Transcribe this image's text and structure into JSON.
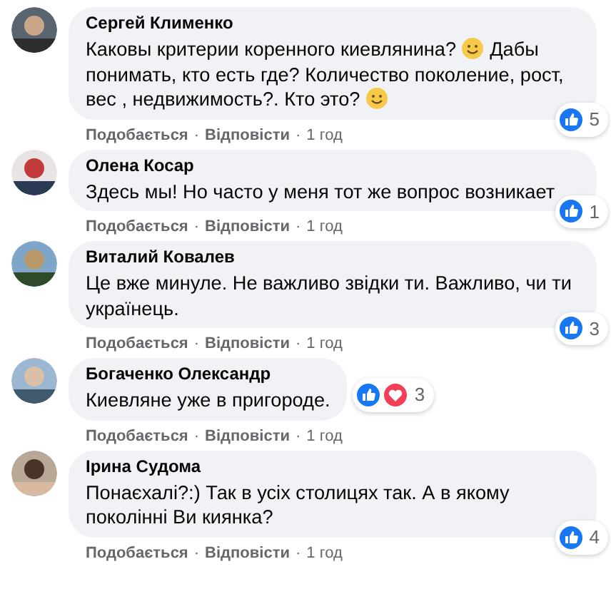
{
  "comments": [
    {
      "author": "Сергей Клименко",
      "lines": [
        [
          {
            "kind": "text",
            "text": "Каковы критерии коренного киевлянина? "
          },
          {
            "kind": "emoji"
          },
          {
            "kind": "text",
            "text": " Дабы"
          }
        ],
        [
          {
            "kind": "text",
            "text": "понимать, кто есть где? Количество поколение, рост,"
          }
        ],
        [
          {
            "kind": "text",
            "text": "вес , недвижимость?. Кто это? "
          },
          {
            "kind": "emoji"
          }
        ]
      ],
      "reactions": {
        "kind": "corner",
        "icons": [
          {
            "kind": "like"
          }
        ],
        "count": "5"
      },
      "actions": [
        {
          "kind": "link",
          "text": "Подобається"
        },
        {
          "kind": "separator",
          "text": "·"
        },
        {
          "kind": "link",
          "text": "Відповісти"
        },
        {
          "kind": "separator",
          "text": "·"
        },
        {
          "kind": "time",
          "text": "1 год"
        }
      ]
    },
    {
      "author": "Олена Косар",
      "lines": [
        [
          {
            "kind": "text",
            "text": "Здесь мы! Но часто у меня тот же вопрос возникает"
          }
        ]
      ],
      "reactions": {
        "kind": "corner",
        "icons": [
          {
            "kind": "like"
          }
        ],
        "count": "1"
      },
      "actions": [
        {
          "kind": "link",
          "text": "Подобається"
        },
        {
          "kind": "separator",
          "text": "·"
        },
        {
          "kind": "link",
          "text": "Відповісти"
        },
        {
          "kind": "separator",
          "text": "·"
        },
        {
          "kind": "time",
          "text": "1 год"
        }
      ]
    },
    {
      "author": "Виталий Ковалев",
      "lines": [
        [
          {
            "kind": "text",
            "text": "Це вже минуле. Не важливо звідки ти. Важливо, чи ти"
          }
        ],
        [
          {
            "kind": "text",
            "text": "українець."
          }
        ]
      ],
      "reactions": {
        "kind": "corner",
        "icons": [
          {
            "kind": "like"
          }
        ],
        "count": "3"
      },
      "actions": [
        {
          "kind": "link",
          "text": "Подобається"
        },
        {
          "kind": "separator",
          "text": "·"
        },
        {
          "kind": "link",
          "text": "Відповісти"
        },
        {
          "kind": "separator",
          "text": "·"
        },
        {
          "kind": "time",
          "text": "1 год"
        }
      ]
    },
    {
      "author": "Богаченко Олександр",
      "lines": [
        [
          {
            "kind": "text",
            "text": "Киевляне уже в пригороде."
          }
        ]
      ],
      "reactions": {
        "kind": "inline",
        "icons": [
          {
            "kind": "like"
          },
          {
            "kind": "love"
          }
        ],
        "count": "3"
      },
      "actions": [
        {
          "kind": "link",
          "text": "Подобається"
        },
        {
          "kind": "separator",
          "text": "·"
        },
        {
          "kind": "link",
          "text": "Відповісти"
        },
        {
          "kind": "separator",
          "text": "·"
        },
        {
          "kind": "time",
          "text": "1 год"
        }
      ]
    },
    {
      "author": "Ірина Судома",
      "lines": [
        [
          {
            "kind": "text",
            "text": "Понаєхалі?:) Так в усіх столицях так. А в якому"
          }
        ],
        [
          {
            "kind": "text",
            "text": "поколінні Ви киянка?"
          }
        ]
      ],
      "reactions": {
        "kind": "corner",
        "icons": [
          {
            "kind": "like"
          }
        ],
        "count": "4"
      },
      "actions": [
        {
          "kind": "link",
          "text": "Подобається"
        },
        {
          "kind": "separator",
          "text": "·"
        },
        {
          "kind": "link",
          "text": "Відповісти"
        },
        {
          "kind": "separator",
          "text": "·"
        },
        {
          "kind": "time",
          "text": "1 год"
        }
      ]
    }
  ]
}
